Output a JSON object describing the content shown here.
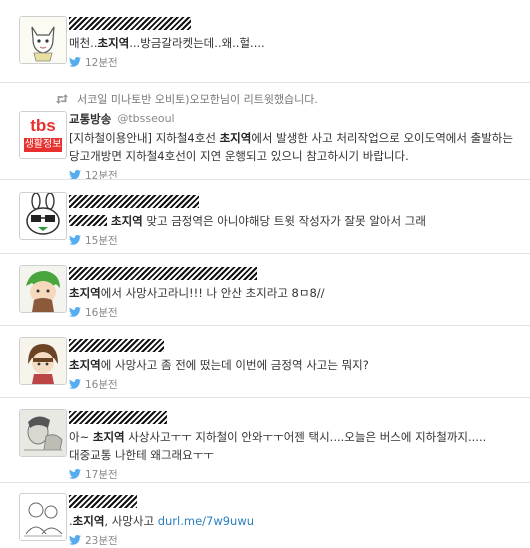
{
  "colors": {
    "accent": "#2a7fbf",
    "text": "#333333",
    "muted": "#888888",
    "bird": "#55acee"
  },
  "tweets": [
    {
      "display_name": "",
      "parts": [
        {
          "t": "매천..",
          "hl": false
        },
        {
          "t": "초지역",
          "hl": true
        },
        {
          "t": "...방금갈라켓는데..왜..헐....",
          "hl": false
        }
      ],
      "time": "12분전",
      "avatar_icon": "cartoon-cat-avatar-icon"
    },
    {
      "retweet_note": "서코일 미나토반 오비토)오모한님이 리트윗했습니다.",
      "display_name": "교통방송",
      "handle": "@tbsseoul",
      "avatar_text_top": "tbs",
      "avatar_text_bottom": "생활정보",
      "parts": [
        {
          "t": "[지하철이용안내] 지하철4호선 ",
          "hl": false
        },
        {
          "t": "초지역",
          "hl": true
        },
        {
          "t": "에서 발생한 사고 처리작업으로 오이도역에서 출발하는 당고개방면 지하철4호선이 지연 운행되고 있으니 참고하시기 바랍니다.",
          "hl": false
        }
      ],
      "time": "12분전"
    },
    {
      "display_name": "",
      "parts": [
        {
          "t": "초지역",
          "hl": true
        },
        {
          "t": " 맞고 금정역은 아니야해당 트윗 작성자가 잘못 알아서 그래",
          "hl": false
        }
      ],
      "time": "15분전",
      "avatar_icon": "glasses-rabbit-avatar-icon"
    },
    {
      "display_name": "",
      "parts": [
        {
          "t": "초지역",
          "hl": true
        },
        {
          "t": "에서 사망사고라니!!! 나 안산 초지라고 8ㅁ8//",
          "hl": false
        }
      ],
      "time": "16분전",
      "avatar_icon": "green-hair-character-avatar-icon"
    },
    {
      "display_name": "",
      "parts": [
        {
          "t": "초지역",
          "hl": true
        },
        {
          "t": "에 사망사고 좀 전에 떴는데 이번에 금정역 사고는 뭐지?",
          "hl": false
        }
      ],
      "time": "16분전",
      "avatar_icon": "brown-hair-character-avatar-icon"
    },
    {
      "display_name": "",
      "parts": [
        {
          "t": "아~ ",
          "hl": false
        },
        {
          "t": "초지역",
          "hl": true
        },
        {
          "t": " 사상사고ㅜㅜ 지하철이 안와ㅜㅜ어젠 택시....오늘은 버스에 지하철까지.....대중교통 나한테 왜그래요ㅜㅜ",
          "hl": false
        }
      ],
      "time": "17분전",
      "avatar_icon": "sketch-photo-avatar-icon"
    },
    {
      "display_name": "",
      "parts": [
        {
          "t": ".",
          "hl": false
        },
        {
          "t": "초지역",
          "hl": true
        },
        {
          "t": ", 사망사고 ",
          "hl": false
        }
      ],
      "link": "durl.me/7w9uwu",
      "time": "23분전",
      "avatar_icon": "line-drawing-avatar-icon"
    }
  ]
}
